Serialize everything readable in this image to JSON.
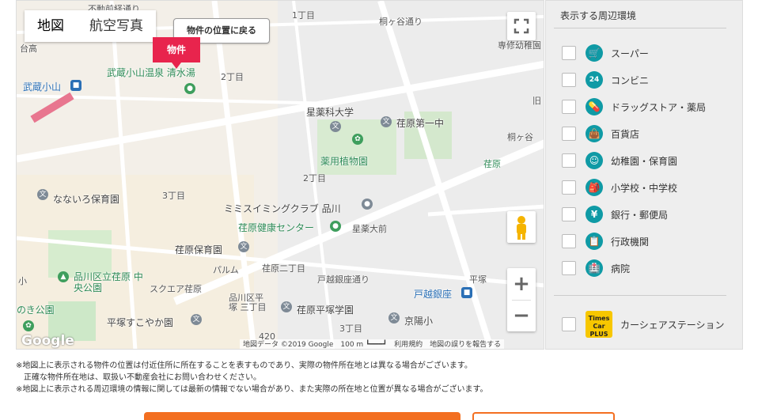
{
  "map": {
    "tabs": [
      {
        "label": "地図"
      },
      {
        "label": "航空写真"
      }
    ],
    "back_button": "物件の位置に戻る",
    "property_pin": "物件",
    "attribution": "地図データ ©2019 Google　100 m ┗━━━┛　利用規約　地図の誤りを報告する",
    "google_logo": "Google",
    "labels": {
      "musashikoyama_onsen": "武蔵小山温泉 清水湯",
      "musashikoyama": "武蔵小山",
      "hoshi_univ": "星薬科大学",
      "ebara_daiichi": "荏原第一中",
      "yakuyo": "薬用植物園",
      "mimi_swim": "ミミスイミングクラブ 品川",
      "ebara_kenko": "荏原健康センター",
      "nanairo": "なないろ保育園",
      "ebara_hoiku": "荏原保育園",
      "ebara_hiratsuka": "荏原平塚学園",
      "shinagawa_park": "品川区立荏原 中央公園",
      "hiratsuka_sukoyaka": "平塚すこやか園",
      "togoshi_ginza": "戸越銀座",
      "keiyo": "京陽小",
      "hoshi_oomae": "星薬大前",
      "ebara_2": "荏原二丁目",
      "shinagawa_ku": "品川区平塚 三丁目",
      "square_ebara": "スクエア荏原",
      "togoshi_street": "戸越銀座通り",
      "kirigaya": "桐ヶ谷通り",
      "hiratsuka": "平塚",
      "nodaiki": "のき公園",
      "c1": "1丁目",
      "c2a": "2丁目",
      "c2b": "2丁目",
      "c3a": "3丁目",
      "c3b": "3丁目",
      "bus": "桐ヶ谷",
      "ebara_sign": "荏原",
      "route": "420",
      "kou": "小",
      "kokai": "台高",
      "fudoumae": "不動前経通り",
      "senshu": "専修幼稚園",
      "kyu": "旧",
      "paru": "パルム"
    }
  },
  "panel": {
    "title": "表示する周辺環境",
    "items": [
      {
        "label": "スーパー",
        "icon": "cart-icon"
      },
      {
        "label": "コンビニ",
        "icon": "convenience-icon"
      },
      {
        "label": "ドラッグストア・薬局",
        "icon": "pill-icon"
      },
      {
        "label": "百貨店",
        "icon": "bag-icon"
      },
      {
        "label": "幼稚園・保育園",
        "icon": "child-icon"
      },
      {
        "label": "小学校・中学校",
        "icon": "school-bag-icon"
      },
      {
        "label": "銀行・郵便局",
        "icon": "yen-icon"
      },
      {
        "label": "行政機関",
        "icon": "clipboard-icon"
      },
      {
        "label": "病院",
        "icon": "hospital-icon"
      }
    ],
    "car_share": {
      "label": "カーシェアステーション",
      "logo_text": "Times Car PLUS"
    }
  },
  "notes": [
    "※地図上に表示される物件の位置は付近住所に所在することを表すものであり、実際の物件所在地とは異なる場合がございます。",
    "　正確な物件所在地は、取扱い不動産会社にお問い合わせください。",
    "※地図上に表示される周辺環境の情報に関しては最新の情報でない場合があり、また実際の所在地と位置が異なる場合がございます。"
  ],
  "icons": {
    "cart": "🛒",
    "convenience": "24",
    "pill": "💊",
    "bag": "👜",
    "child": "☺",
    "school": "🎒",
    "yen": "¥",
    "clipboard": "📋",
    "hospital": "🏥"
  }
}
